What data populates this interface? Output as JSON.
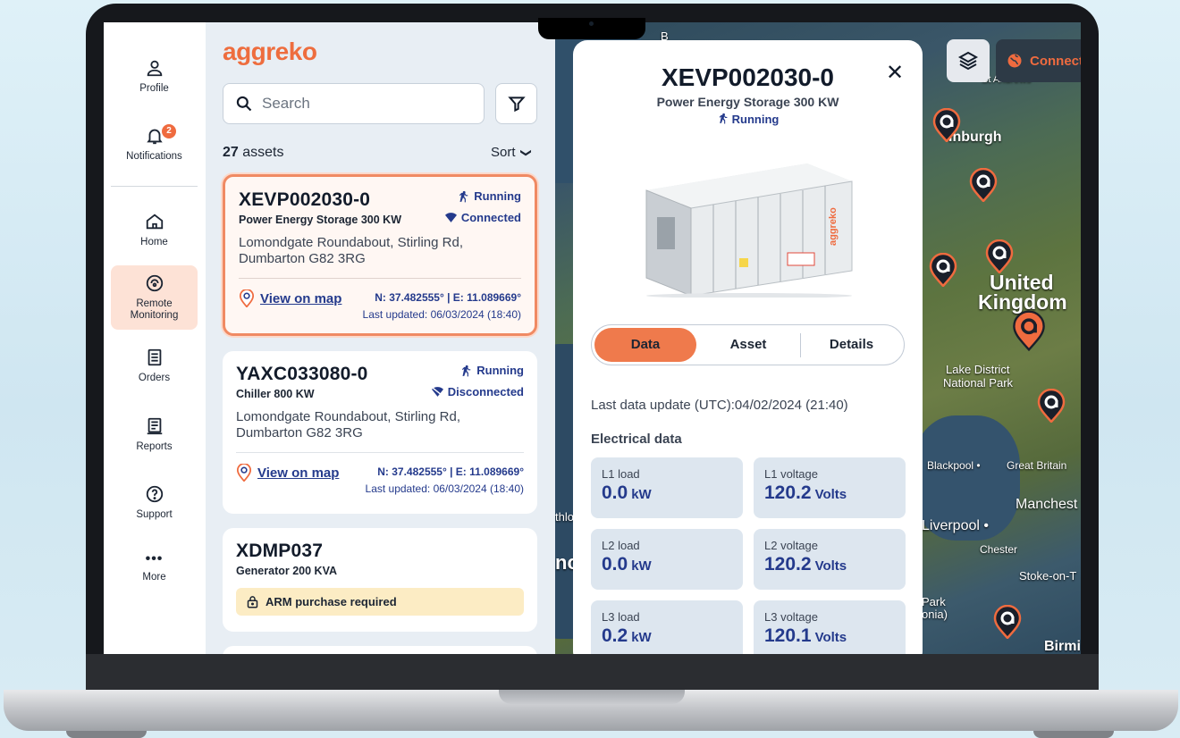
{
  "app": {
    "brand": "aggreko"
  },
  "rail": {
    "profile": "Profile",
    "notifications": "Notifications",
    "notifications_count": "2",
    "home": "Home",
    "remote_monitoring_1": "Remote",
    "remote_monitoring_2": "Monitoring",
    "orders": "Orders",
    "reports": "Reports",
    "support": "Support",
    "more_icon": "•••",
    "more": "More"
  },
  "list": {
    "search_placeholder": "Search",
    "asset_count": "27",
    "asset_count_suffix": " assets",
    "sort_label": "Sort",
    "sort_chevron": "❯",
    "cards": [
      {
        "id": "XEVP002030-0",
        "model": "Power Energy Storage 300 KW",
        "run_status": "Running",
        "conn_status": "Connected",
        "address_1": "Lomondgate Roundabout, Stirling Rd,",
        "address_2": "Dumbarton G82 3RG",
        "view_map": "View on map",
        "coords": "N: 37.482555° | E: 11.089669°",
        "updated": "Last updated: 06/03/2024 (18:40)"
      },
      {
        "id": "YAXC033080-0",
        "model": "Chiller 800 KW",
        "run_status": "Running",
        "conn_status": "Disconnected",
        "address_1": "Lomondgate Roundabout, Stirling Rd,",
        "address_2": "Dumbarton G82 3RG",
        "view_map": "View on map",
        "coords": "N: 37.482555° | E: 11.089669°",
        "updated": "Last updated: 06/03/2024 (18:40)"
      },
      {
        "id": "XDMP037",
        "model": "Generator 200 KVA",
        "arm": "ARM purchase required"
      }
    ]
  },
  "map": {
    "labels": {
      "standrews": "St Andrews",
      "edinburgh": "inburgh",
      "uk1": "United",
      "uk2": "Kingdom",
      "lake1": "Lake District",
      "lake2": "National Park",
      "blackpool": "Blackpool •",
      "greatbritain": "Great Britain",
      "manchester": "Manchest",
      "liverpool": "Liverpool •",
      "chester": "Chester",
      "stoke": "Stoke-on-T",
      "park1": "Park",
      "park2": "onia)",
      "birmi": "Birmi",
      "thlo": "thlo",
      "nc": "nc",
      "b": "B"
    },
    "connect_label": "Connect"
  },
  "detail": {
    "id": "XEVP002030-0",
    "model": "Power Energy Storage 300 KW",
    "status": "Running",
    "close": "✕",
    "tabs": [
      "Data",
      "Asset",
      "Details"
    ],
    "last_update": "Last data update (UTC):04/02/2024 (21:40)",
    "section": "Electrical data",
    "tiles": [
      {
        "label": "L1 load",
        "value": "0.0",
        "unit": "kW"
      },
      {
        "label": "L1 voltage",
        "value": "120.2",
        "unit": "Volts"
      },
      {
        "label": "L2 load",
        "value": "0.0",
        "unit": "kW"
      },
      {
        "label": "L2 voltage",
        "value": "120.2",
        "unit": "Volts"
      },
      {
        "label": "L3 load",
        "value": "0.2",
        "unit": "kW"
      },
      {
        "label": "L3 voltage",
        "value": "120.1",
        "unit": "Volts"
      }
    ]
  },
  "colors": {
    "accent": "#ef6b3f",
    "navy": "#243a8c",
    "list_bg": "#e8eef4"
  }
}
